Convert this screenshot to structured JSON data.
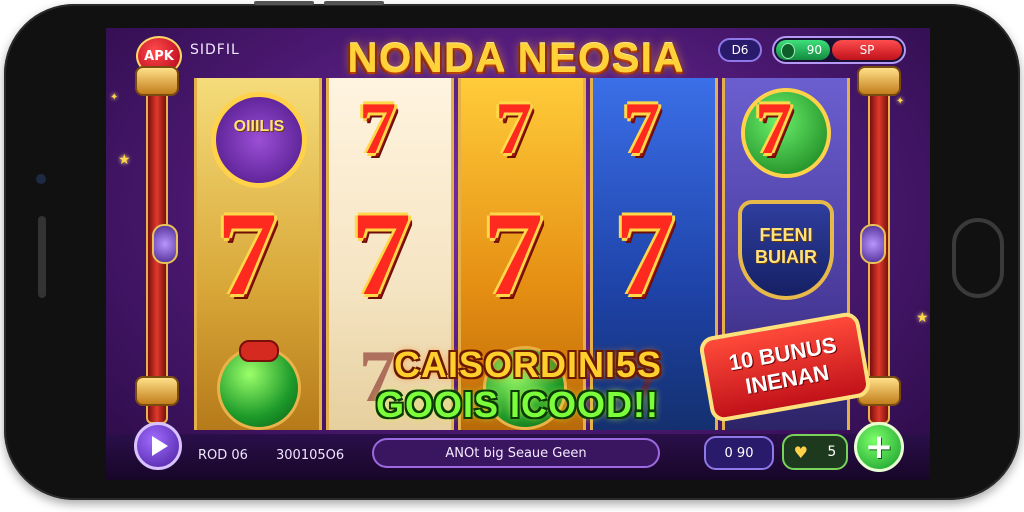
{
  "header": {
    "apk_badge": "APK",
    "left_label": "SIDFIL",
    "title": "NONDA NEOSIA",
    "pill_left": "D6",
    "pill_green": "90",
    "pill_red": "SP"
  },
  "reels": {
    "top_badge": "OIIILIS",
    "symbol_seven": "7",
    "shield_line1": "FEENI",
    "shield_line2": "BUIAIR"
  },
  "promo": {
    "line1": "CAISORDINI5S",
    "line2": "GOOIS ICOOD!!",
    "bonus_line1": "10 BUNUS",
    "bonus_line2": "INENAN"
  },
  "footer": {
    "left_value": "ROD 06",
    "middle_value": "300105O6",
    "message": "ANOt big Seaue Geen",
    "bet": "0  90",
    "coins": "5",
    "add_label": "+"
  },
  "colors": {
    "title_gold": "#ffd23a",
    "promo_gold": "#ffcf2e",
    "promo_green": "#7cff3a",
    "bonus_red": "#c1121a",
    "background_purple": "#4a1870"
  },
  "icons": [
    "play-icon",
    "heart-icon",
    "plus-icon",
    "star-icon"
  ]
}
